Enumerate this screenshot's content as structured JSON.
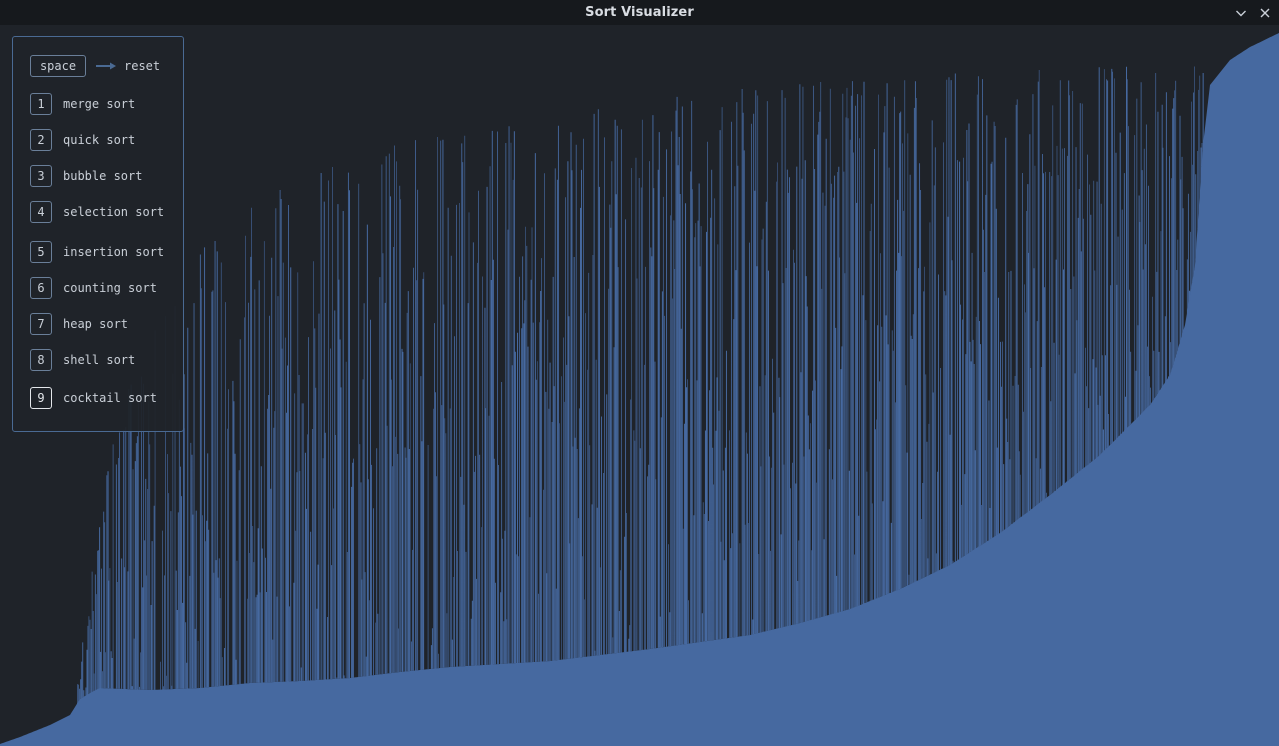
{
  "window": {
    "title": "Sort Visualizer",
    "controls": [
      "chevron-down-icon",
      "close-icon"
    ]
  },
  "colors": {
    "background": "#1f2329",
    "titlebar": "#16191d",
    "bar": "#4669a0",
    "panel_border": "#4a6a93",
    "key_border": "#6a7f99",
    "active_key_border": "#e4e7eb",
    "text": "#c9cfd7"
  },
  "controls_panel": {
    "reset": {
      "key": "space",
      "label": "reset"
    },
    "algorithms": [
      {
        "key": "1",
        "label": "merge sort"
      },
      {
        "key": "2",
        "label": "quick sort"
      },
      {
        "key": "3",
        "label": "bubble sort"
      },
      {
        "key": "4",
        "label": "selection sort"
      },
      {
        "key": "5",
        "label": "insertion sort"
      },
      {
        "key": "6",
        "label": "counting sort"
      },
      {
        "key": "7",
        "label": "heap sort"
      },
      {
        "key": "8",
        "label": "shell sort"
      },
      {
        "key": "9",
        "label": "cocktail sort"
      }
    ],
    "active_key": "9"
  }
}
